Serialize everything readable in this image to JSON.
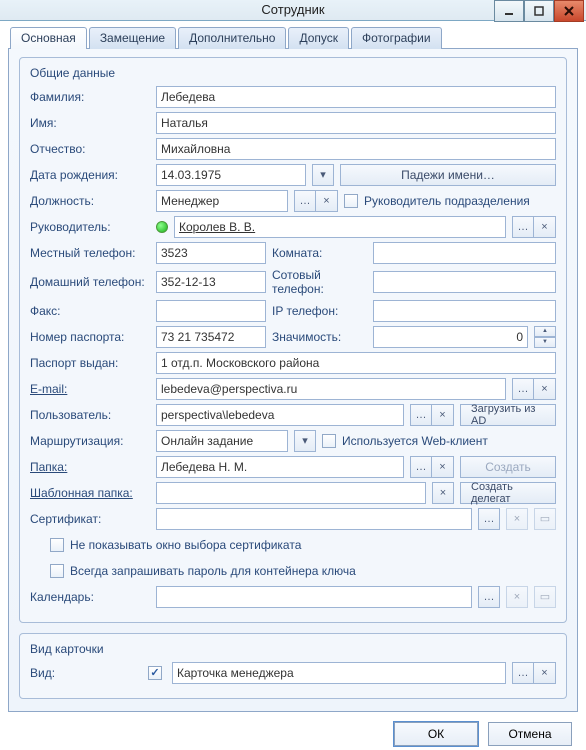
{
  "window": {
    "title": "Сотрудник"
  },
  "tabs": [
    "Основная",
    "Замещение",
    "Дополнительно",
    "Допуск",
    "Фотографии"
  ],
  "active_tab": 0,
  "group_general": {
    "title": "Общие данные",
    "labels": {
      "lastname": "Фамилия:",
      "firstname": "Имя:",
      "patronymic": "Отчество:",
      "birthdate": "Дата рождения:",
      "name_cases_btn": "Падежи имени…",
      "position": "Должность:",
      "head_of_dept": "Руководитель подразделения",
      "manager": "Руководитель:",
      "local_phone": "Местный телефон:",
      "room": "Комната:",
      "home_phone": "Домашний телефон:",
      "cell_phone": "Сотовый телефон:",
      "fax": "Факс:",
      "ip_phone": "IP телефон:",
      "passport_no": "Номер паспорта:",
      "significance": "Значимость:",
      "passport_issued": "Паспорт выдан:",
      "email": "E-mail:",
      "user": "Пользователь:",
      "load_from_ad_btn": "Загрузить из AD",
      "routing": "Маршрутизация:",
      "web_client": "Используется Web-клиент",
      "folder": "Папка:",
      "create_btn": "Создать",
      "template_folder": "Шаблонная папка:",
      "create_delegate_btn": "Создать делегат",
      "certificate": "Сертификат:",
      "hide_cert_dialog": "Не показывать окно выбора сертификата",
      "always_ask_pwd": "Всегда запрашивать пароль для контейнера ключа",
      "calendar": "Календарь:"
    },
    "values": {
      "lastname": "Лебедева",
      "firstname": "Наталья",
      "patronymic": "Михайловна",
      "birthdate": "14.03.1975",
      "position": "Менеджер",
      "head_of_dept_checked": false,
      "manager": "Королев В. В.",
      "local_phone": "3523",
      "room": "",
      "home_phone": "352-12-13",
      "cell_phone": "",
      "fax": "",
      "ip_phone": "",
      "passport_no": "73 21 735472",
      "significance": "0",
      "passport_issued": "1 отд.п. Московского района",
      "email": "lebedeva@perspectiva.ru",
      "user": "perspectiva\\lebedeva",
      "routing": "Онлайн задание",
      "web_client_checked": false,
      "folder": "Лебедева Н. М.",
      "template_folder": "",
      "certificate": "",
      "hide_cert_dialog_checked": false,
      "always_ask_pwd_checked": false,
      "calendar": ""
    }
  },
  "group_card": {
    "title": "Вид карточки",
    "labels": {
      "kind": "Вид:"
    },
    "enabled": true,
    "value": "Карточка менеджера"
  },
  "footer": {
    "ok": "ОК",
    "cancel": "Отмена"
  },
  "icons": {
    "dots": "…",
    "x": "×",
    "dropdown": "▾",
    "spin_up": "▲",
    "spin_down": "▼"
  }
}
